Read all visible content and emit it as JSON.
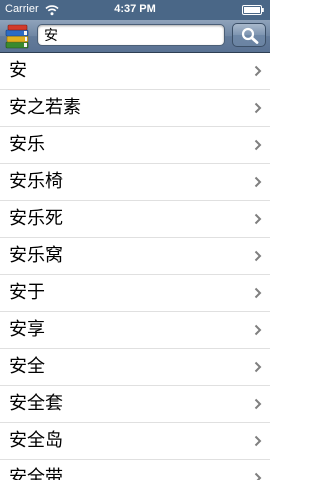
{
  "status_bar": {
    "carrier": "Carrier",
    "time": "4:37 PM"
  },
  "search": {
    "value": "安"
  },
  "results": [
    "安",
    "安之若素",
    "安乐",
    "安乐椅",
    "安乐死",
    "安乐窝",
    "安于",
    "安享",
    "安全",
    "安全套",
    "安全岛",
    "安全带"
  ],
  "colors": {
    "status_bar": "#4a6787",
    "nav_bar": "#6f86a3",
    "chevron": "#7f7f7f"
  },
  "icons": {
    "app": "books-stack-icon",
    "search": "magnifier-icon",
    "row_accessory": "chevron-right-icon"
  }
}
